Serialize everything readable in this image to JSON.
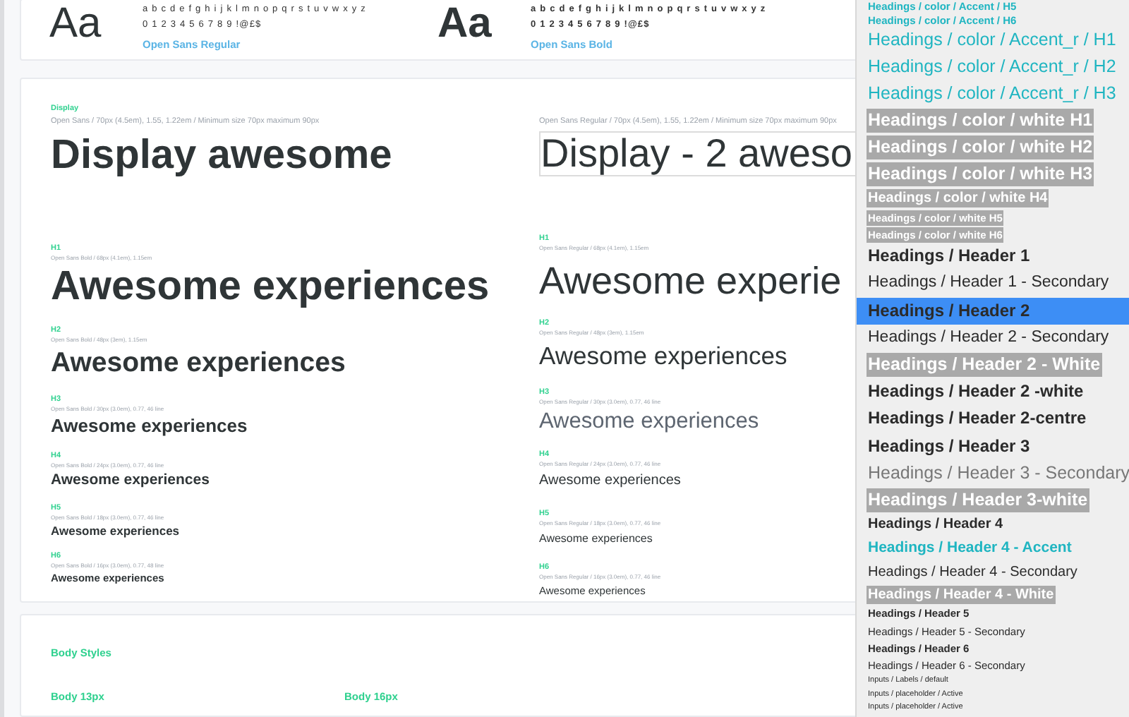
{
  "fonts": [
    {
      "kind": "regular",
      "sample": "Aa",
      "alphabet": "a b c d e f g h i j k l m n o p q r s t u v w x y z",
      "digits": "0 1 2 3 4 5 6 7 8 9 !@£$",
      "name": "Open Sans Regular"
    },
    {
      "kind": "bold",
      "sample": "Aa",
      "alphabet": "a b c d e f g h i j k l m n o p q r s t u v w x y z",
      "digits": "0 1 2 3 4 5 6 7 8 9 !@£$",
      "name": "Open Sans Bold"
    }
  ],
  "type_scale": {
    "columns": [
      {
        "kind": "bold",
        "display": {
          "label": "Display",
          "spec": "Open Sans / 70px (4.5em), 1.55, 1.22em /  Minimum size 70px maximum 90px",
          "sample": "Display awesome"
        },
        "headings": [
          {
            "label": "H1",
            "spec": "Open Sans Bold / 68px (4.1em), 1.15em",
            "sample": "Awesome experiences"
          },
          {
            "label": "H2",
            "spec": "Open Sans Bold / 48px (3em), 1.15em",
            "sample": "Awesome experiences"
          },
          {
            "label": "H3",
            "spec": "Open Sans Bold / 30px (3.0em), 0.77, 46 line",
            "sample": "Awesome experiences"
          },
          {
            "label": "H4",
            "spec": "Open Sans Bold / 24px (3.0em), 0.77, 46 line",
            "sample": "Awesome experiences"
          },
          {
            "label": "H5",
            "spec": "Open Sans Bold / 18px (3.0em), 0.77, 46 line",
            "sample": "Awesome experiences"
          },
          {
            "label": "H6",
            "spec": "Open Sans Bold / 16px (3.0em), 0.77, 48 line",
            "sample": "Awesome experiences"
          }
        ]
      },
      {
        "kind": "regular",
        "display": {
          "spec": "Open Sans Regular / 70px (4.5em), 1.55, 1.22em /  Minimum size 70px maximum 90px",
          "sample": "Display - 2 aweso"
        },
        "headings": [
          {
            "label": "H1",
            "spec": "Open Sans Regular / 68px (4.1em), 1.15em",
            "sample": "Awesome experie"
          },
          {
            "label": "H2",
            "spec": "Open Sans Regular / 48px (3em), 1.15em",
            "sample": "Awesome experiences"
          },
          {
            "label": "H3",
            "spec": "Open Sans Regular / 30px (3.0em), 0.77, 46 line",
            "sample": "Awesome experiences"
          },
          {
            "label": "H4",
            "spec": "Open Sans Regular / 24px (3.0em), 0.77, 46 line",
            "sample": "Awesome experiences"
          },
          {
            "label": "H5",
            "spec": "Open Sans Regular / 18px (3.0em), 0.77, 46 line",
            "sample": "Awesome experiences"
          },
          {
            "label": "H6",
            "spec": "Open Sans Regular / 16px (3.0em), 0.77, 46 line",
            "sample": "Awesome experiences"
          }
        ]
      }
    ]
  },
  "body_styles": {
    "title": "Body Styles",
    "columns": [
      "Body 13px",
      "Body 16px"
    ]
  },
  "style_menu": {
    "items": [
      {
        "label": "Headings / color / Accent / H5",
        "kind": "accentxs",
        "selected": false
      },
      {
        "label": "Headings / color / Accent / H6",
        "kind": "accentxs",
        "selected": false
      },
      {
        "label": "Headings / color / Accent_r / H1",
        "kind": "accentlg",
        "selected": false
      },
      {
        "label": "Headings / color / Accent_r / H2",
        "kind": "accentlg",
        "selected": false
      },
      {
        "label": "Headings / color / Accent_r / H3",
        "kind": "accentlg",
        "selected": false
      },
      {
        "label": "Headings / color / white H1",
        "kind": "whitelg",
        "selected": false
      },
      {
        "label": "Headings / color / white H2",
        "kind": "whitelg",
        "selected": false
      },
      {
        "label": "Headings / color / white H3",
        "kind": "whitelg",
        "selected": false
      },
      {
        "label": "Headings / color / white H4",
        "kind": "whitemd",
        "selected": false
      },
      {
        "label": "Headings / color / white H5",
        "kind": "whitesm",
        "selected": false
      },
      {
        "label": "Headings / color / white H6",
        "kind": "whitesm",
        "selected": false
      },
      {
        "label": "Headings / Header 1",
        "kind": "boldlg",
        "selected": false
      },
      {
        "label": "Headings / Header 1 - Secondary",
        "kind": "regularlg",
        "selected": false
      },
      {
        "label": "Headings / Header 2",
        "kind": "boldlg",
        "selected": true
      },
      {
        "label": "Headings / Header 2 - Secondary",
        "kind": "regularlg",
        "selected": false
      },
      {
        "label": "Headings / Header 2 - White",
        "kind": "whitelg",
        "selected": false
      },
      {
        "label": "Headings / Header 2 -white",
        "kind": "boldlg",
        "selected": false
      },
      {
        "label": "Headings / Header 2-centre",
        "kind": "boldlg",
        "selected": false
      },
      {
        "label": "Headings / Header 3",
        "kind": "boldlg",
        "selected": false
      },
      {
        "label": "Headings / Header 3 - Secondary",
        "kind": "secondarylg",
        "selected": false
      },
      {
        "label": "Headings / Header 3-white",
        "kind": "whitelg",
        "selected": false
      },
      {
        "label": "Headings / Header 4",
        "kind": "boldmd",
        "selected": false
      },
      {
        "label": "Headings / Header 4 - Accent",
        "kind": "accentmd",
        "selected": false
      },
      {
        "label": "Headings / Header 4 - Secondary",
        "kind": "regularmd",
        "selected": false
      },
      {
        "label": "Headings / Header 4 - White",
        "kind": "whitemd",
        "selected": false
      },
      {
        "label": "Headings / Header 5",
        "kind": "boldsm",
        "selected": false
      },
      {
        "label": "Headings / Header 5 - Secondary",
        "kind": "regularsm",
        "selected": false
      },
      {
        "label": "Headings / Header 6",
        "kind": "boldsm",
        "selected": false
      },
      {
        "label": "Headings / Header 6 - Secondary",
        "kind": "regularsm",
        "selected": false
      },
      {
        "label": "Inputs / Labels / default",
        "kind": "regularxs",
        "selected": false
      },
      {
        "label": "Inputs / placeholder / Active",
        "kind": "regularxs",
        "selected": false
      },
      {
        "label": "Inputs / placeholder / Active",
        "kind": "regularxs",
        "selected": false
      }
    ]
  }
}
